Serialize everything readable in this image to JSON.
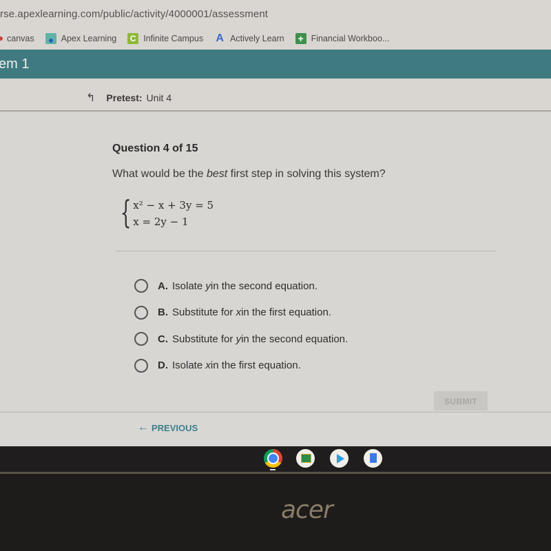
{
  "browser": {
    "url": "rse.apexlearning.com/public/activity/4000001/assessment",
    "bookmarks": [
      {
        "label": "canvas",
        "icon": "canvas-icon"
      },
      {
        "label": "Apex Learning",
        "icon": "apex-learning-icon"
      },
      {
        "label": "Infinite Campus",
        "icon": "infinite-campus-icon",
        "glyph": "C"
      },
      {
        "label": "Actively Learn",
        "icon": "actively-learn-icon",
        "glyph": "A"
      },
      {
        "label": "Financial Workboo...",
        "icon": "financial-workbook-icon",
        "glyph": "+"
      }
    ]
  },
  "appbar": {
    "title": "em 1",
    "color": "#3f7a80"
  },
  "subheader": {
    "back_icon": "arrow-up-left-icon",
    "label": "Pretest:",
    "unit": "Unit 4"
  },
  "question": {
    "number_label": "Question 4 of 15",
    "text_before": "What would be the ",
    "text_emphasis": "best",
    "text_after": " first step in solving this system?",
    "system": {
      "eq1": "x² − x + 3y = 5",
      "eq2": "x = 2y − 1"
    }
  },
  "options": [
    {
      "letter": "A.",
      "pre": "Isolate ",
      "var": "y",
      "post": " in the second equation.",
      "selected": false
    },
    {
      "letter": "B.",
      "pre": "Substitute for ",
      "var": "x",
      "post": " in the first equation.",
      "selected": false
    },
    {
      "letter": "C.",
      "pre": "Substitute for ",
      "var": "y",
      "post": " in the second equation.",
      "selected": false
    },
    {
      "letter": "D.",
      "pre": "Isolate ",
      "var": "x",
      "post": " in the first equation.",
      "selected": false
    }
  ],
  "actions": {
    "submit_label": "SUBMIT",
    "previous_label": "PREVIOUS",
    "previous_arrow": "←"
  },
  "shelf": {
    "apps": [
      "Chrome",
      "Google Classroom",
      "Play Store",
      "Google Docs"
    ]
  },
  "device": {
    "brand": "acer"
  }
}
